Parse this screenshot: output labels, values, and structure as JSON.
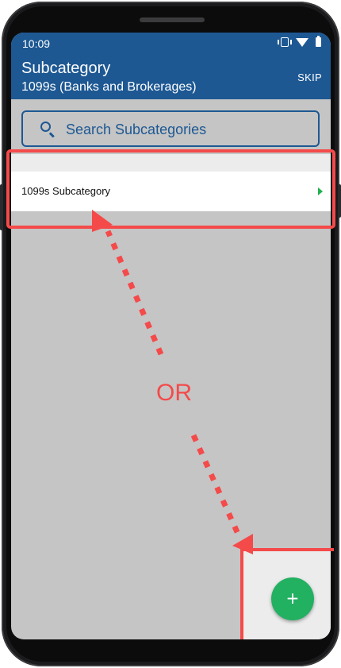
{
  "status_bar": {
    "time": "10:09",
    "icons": [
      "vibrate-icon",
      "wifi-icon",
      "battery-icon"
    ]
  },
  "app_bar": {
    "title": "Subcategory",
    "subtitle": "1099s (Banks and Brokerages)",
    "skip_label": "SKIP"
  },
  "search": {
    "placeholder": "Search Subcategories"
  },
  "list": {
    "items": [
      {
        "label": "1099s Subcategory"
      }
    ]
  },
  "fab": {
    "icon": "plus",
    "symbol": "+"
  },
  "annotation": {
    "or_label": "OR"
  },
  "colors": {
    "app_bar": "#1d5893",
    "accent_green": "#22b061",
    "annotation_red": "#f44a4a",
    "screen_background": "#c5c5c5"
  }
}
